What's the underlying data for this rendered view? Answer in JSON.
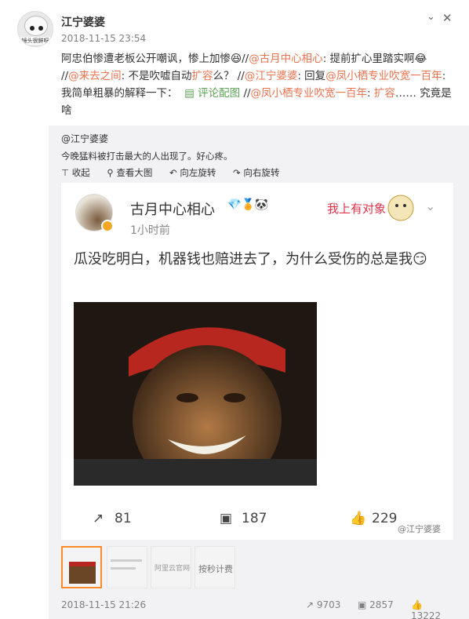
{
  "user": {
    "name": "江宁婆婆",
    "avatar_caption": "镜头很鲜呀",
    "timestamp": "2018-11-15 23:54"
  },
  "post": {
    "p1": "阿忠伯惨遭老板公开嘲讽，惨上加惨",
    "e1": "😆",
    "sep1": "//",
    "m1": "@古月中心相心",
    "t2": ": 提前扩心里踏实啊",
    "e2": "😂",
    "sep2": "//",
    "m2": "@来去之间",
    "t3": ": 不是吹嘘自动",
    "kw1": "扩容",
    "t4": "么？ //",
    "m3": "@江宁婆婆",
    "t5": ": 回复",
    "m4": "@凤小栖专业吹宽一百年",
    "t6": ": 我简单粗暴的解释一下：",
    "link1": "评论配图",
    "sep3": "//",
    "m5": "@凤小栖专业吹宽一百年",
    "t7": ": ",
    "kw2": "扩容",
    "t8": "…… 究竟是啥"
  },
  "repost": {
    "author": "@江宁婆婆",
    "text": "今晚猛料被打击最大的人出现了。好心疼。",
    "actions": [
      "收起",
      "查看大图",
      "向左旋转",
      "向右旋转"
    ]
  },
  "embed": {
    "name": "古月中心相心",
    "time": "1小时前",
    "sticker_text": "我上有对象",
    "text": "瓜没吃明白，机器钱也赔进去了，为什么受伤的总是我",
    "emoji": "😏",
    "reposts": "81",
    "comments": "187",
    "likes": "229"
  },
  "watermark": "@江宁婆婆",
  "thumbnails": [
    "",
    "",
    "阿里云官网去",
    "按秒计费"
  ],
  "footer": {
    "timestamp": "2018-11-15 21:26",
    "reposts": "9703",
    "comments": "2857",
    "likes": "13222"
  },
  "colors": {
    "link": "#eb7350",
    "mention_green": "#5ca356",
    "accent": "#f98b2a"
  }
}
